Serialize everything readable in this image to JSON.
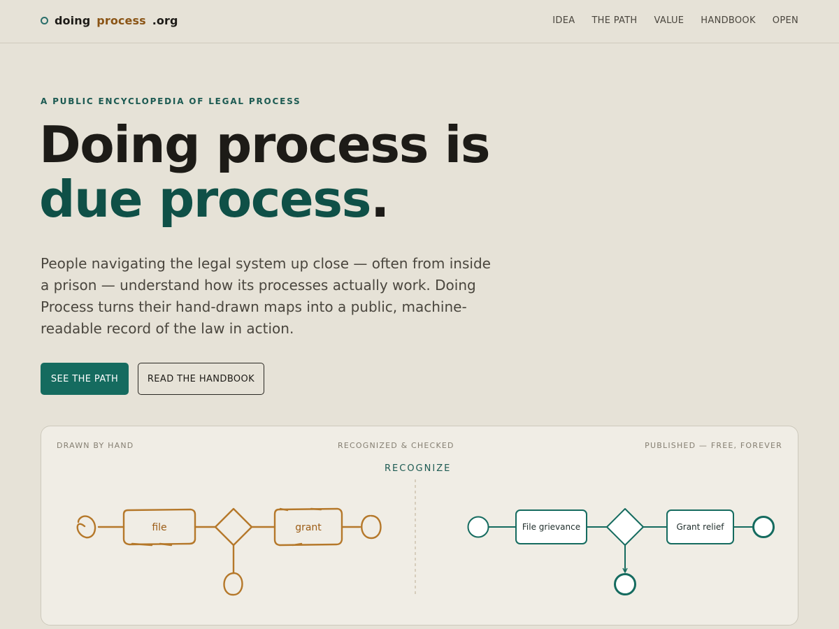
{
  "header": {
    "logo_part1": "doing",
    "logo_part2": "process",
    "logo_part3": ".org",
    "nav": [
      "IDEA",
      "THE PATH",
      "VALUE",
      "HANDBOOK",
      "OPEN"
    ]
  },
  "hero": {
    "kicker": "A PUBLIC ENCYCLOPEDIA OF LEGAL PROCESS",
    "headline_line1": "Doing process is",
    "headline_line2": "due process",
    "headline_period": ".",
    "lede": "People navigating the legal system up close — often from inside a prison — understand how its processes actually work. Doing Process turns their hand-drawn maps into a public, machine-readable record of the law in action.",
    "primary_button": "SEE THE PATH",
    "secondary_button": "READ THE HANDBOOK"
  },
  "diagram": {
    "label_left": "DRAWN BY HAND",
    "label_middle": "RECOGNIZED & CHECKED",
    "label_right": "PUBLISHED — FREE, FOREVER",
    "divider_label": "RECOGNIZE",
    "hand_steps": [
      "file",
      "grant"
    ],
    "clean_steps": [
      "File grievance",
      "Grant relief"
    ]
  },
  "colors": {
    "background": "#e6e2d7",
    "accent_teal": "#156b5f",
    "hand_ochre": "#b5782a",
    "text_dark": "#1d1b17"
  }
}
